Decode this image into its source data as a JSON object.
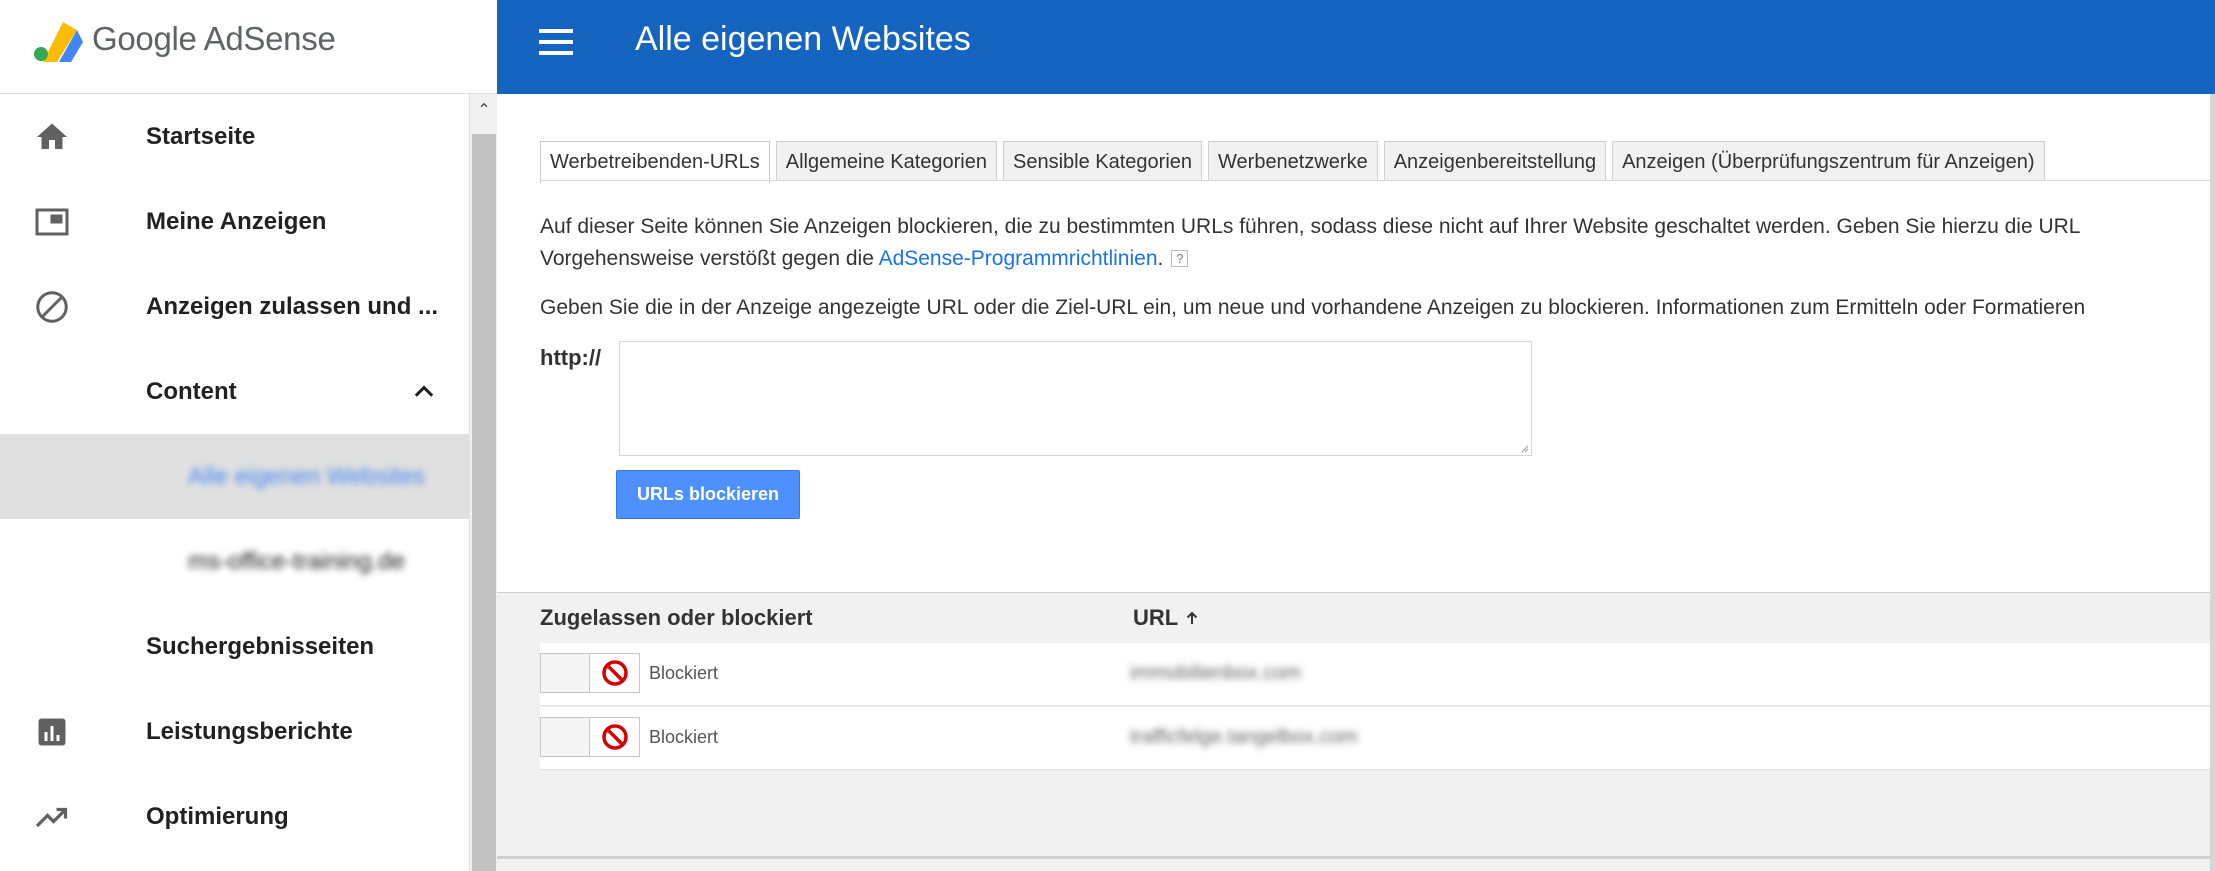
{
  "app": {
    "logo_text": "Google AdSense",
    "brand_colors": {
      "yellow": "#fbbc04",
      "blue": "#4285f4",
      "header": "#1565c0"
    }
  },
  "header": {
    "menu_icon": "hamburger-menu-icon",
    "title": "Alle eigenen Websites"
  },
  "sidebar": {
    "items": [
      {
        "label": "Startseite",
        "icon": "home-icon"
      },
      {
        "label": "Meine Anzeigen",
        "icon": "ad-units-icon"
      },
      {
        "label": "Anzeigen zulassen und ...",
        "icon": "block-icon"
      },
      {
        "label": "Content",
        "icon": "chevron-up-icon"
      },
      {
        "label": "Alle eigenen Websites"
      },
      {
        "label": "ms-office-training.de"
      },
      {
        "label": "Suchergebnisseiten"
      },
      {
        "label": "Leistungsberichte",
        "icon": "bar-chart-icon"
      },
      {
        "label": "Optimierung",
        "icon": "trending-up-icon"
      }
    ]
  },
  "tabs": [
    {
      "label": "Werbetreibenden-URLs",
      "active": true
    },
    {
      "label": "Allgemeine Kategorien"
    },
    {
      "label": "Sensible Kategorien"
    },
    {
      "label": "Werbenetzwerke"
    },
    {
      "label": "Anzeigenbereitstellung"
    },
    {
      "label": "Anzeigen (Überprüfungszentrum für Anzeigen)"
    }
  ],
  "content": {
    "intro_line1": "Auf dieser Seite können Sie Anzeigen blockieren, die zu bestimmten URLs führen, sodass diese nicht auf Ihrer Website geschaltet werden. Geben Sie hierzu die URL",
    "intro_line2_prefix": "Vorgehensweise verstößt gegen die ",
    "policy_link": "AdSense-Programmrichtlinien",
    "intro_line2_suffix": ".",
    "help_badge": "?",
    "instruction": "Geben Sie die in der Anzeige angezeigte URL oder die Ziel-URL ein, um neue und vorhandene Anzeigen zu blockieren. Informationen zum Ermitteln oder Formatieren",
    "http_prefix": "http://",
    "url_input_value": "",
    "block_button": "URLs blockieren"
  },
  "table": {
    "columns": [
      "Zugelassen oder blockiert",
      "URL"
    ],
    "rows": [
      {
        "status": "Blockiert",
        "url": "immobilienbox.com"
      },
      {
        "status": "Blockiert",
        "url": "trafficfelge.tangelbox.com"
      }
    ]
  }
}
